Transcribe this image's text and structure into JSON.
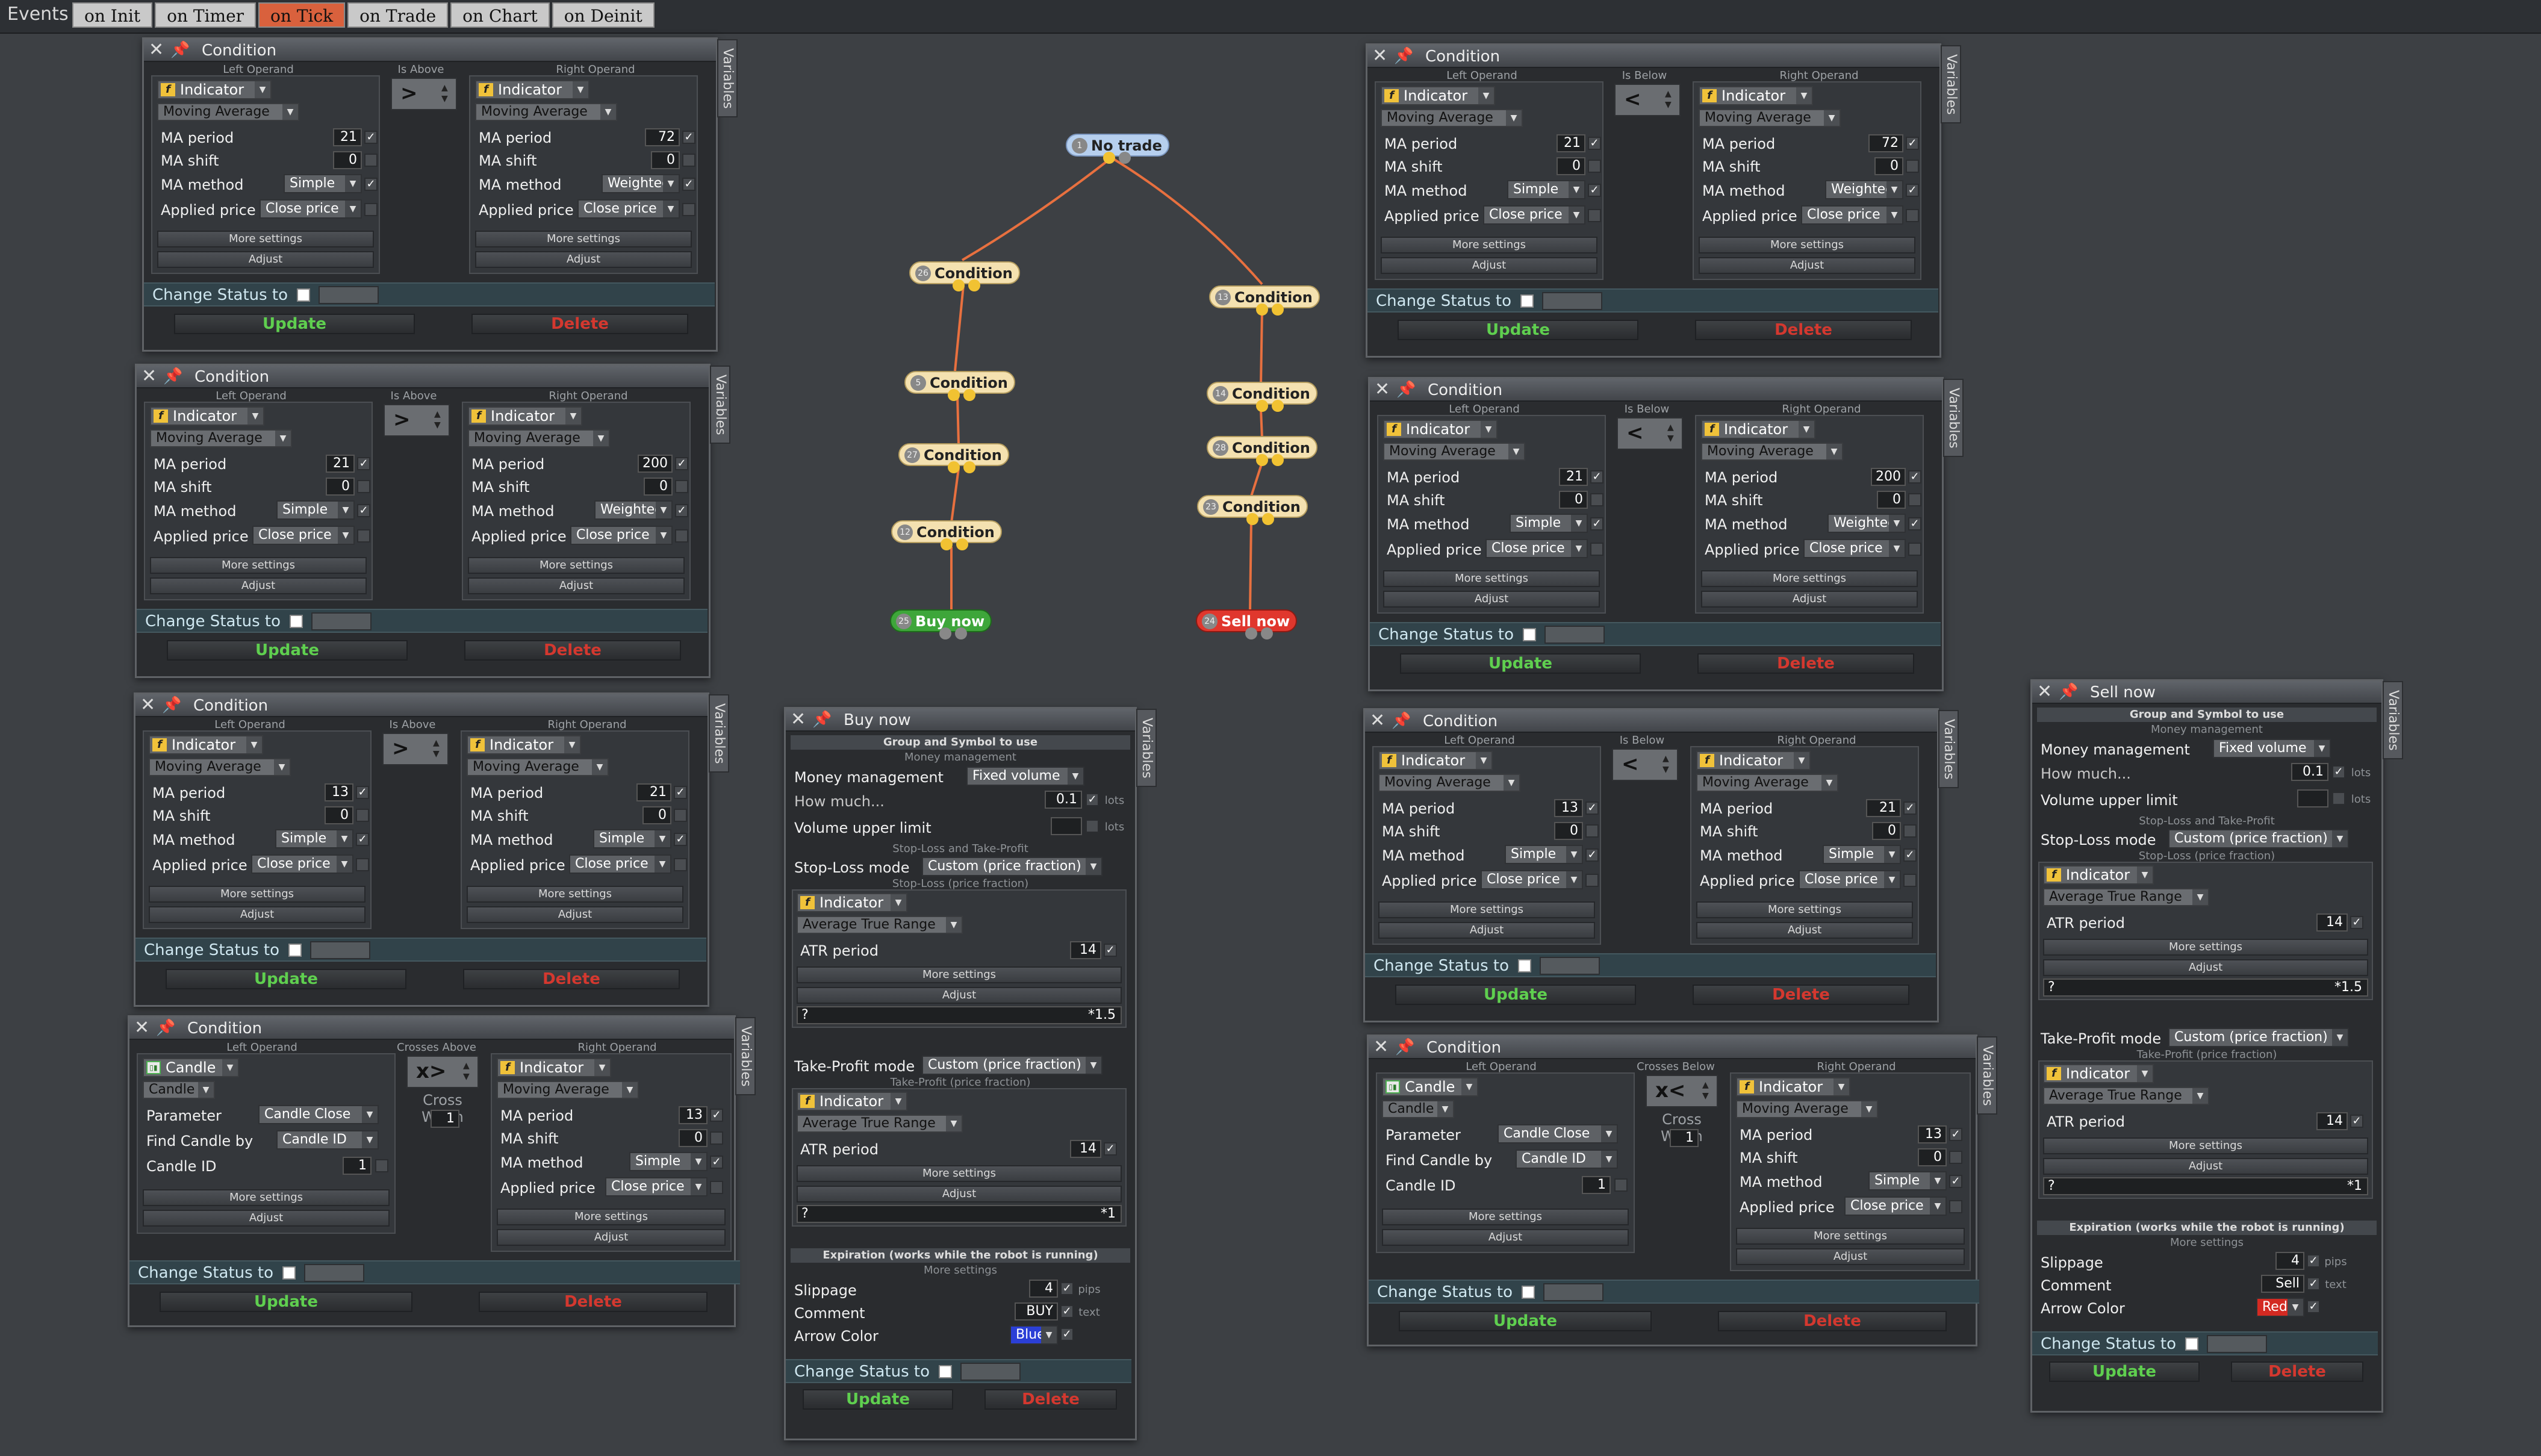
{
  "topbar": {
    "events_label": "Events",
    "tabs": [
      "on Init",
      "on Timer",
      "on Tick",
      "on Trade",
      "on Chart",
      "on Deinit"
    ],
    "active_tab": "on Tick"
  },
  "common": {
    "condition_title": "Condition",
    "variables_tab": "Variables",
    "left_operand": "Left Operand",
    "right_operand": "Right Operand",
    "indicator": "Indicator",
    "candle": "Candle",
    "candle_short": "Candle",
    "moving_average": "Moving Average",
    "ma_period": "MA period",
    "ma_shift": "MA shift",
    "ma_method": "MA method",
    "applied_price": "Applied price",
    "close_price": "Close price",
    "simple": "Simple",
    "weighted": "Weighted",
    "more_settings": "More settings",
    "adjust": "Adjust",
    "change_status": "Change Status to",
    "update": "Update",
    "delete": "Delete",
    "parameter": "Parameter",
    "candle_close": "Candle Close",
    "find_candle_by": "Find Candle by",
    "candle_id_sel": "Candle ID",
    "candle_id": "Candle ID",
    "cross_width": "Cross Width",
    "zero": "0",
    "one": "1"
  },
  "conditions": [
    {
      "relation": "Is Above",
      "symbol": ">",
      "left_period": "21",
      "right_period": "72",
      "right_method": "Weighted"
    },
    {
      "relation": "Is Above",
      "symbol": ">",
      "left_period": "21",
      "right_period": "200",
      "right_method": "Weighted"
    },
    {
      "relation": "Is Above",
      "symbol": ">",
      "left_period": "13",
      "right_period": "21",
      "right_method": "Simple"
    },
    {
      "relation": "Crosses Above",
      "symbol": "x>",
      "right_period": "13"
    },
    {
      "relation": "Is Below",
      "symbol": "<",
      "left_period": "21",
      "right_period": "72",
      "right_method": "Weighted"
    },
    {
      "relation": "Is Below",
      "symbol": "<",
      "left_period": "21",
      "right_period": "200",
      "right_method": "Weighted"
    },
    {
      "relation": "Is Below",
      "symbol": "<",
      "left_period": "13",
      "right_period": "21",
      "right_method": "Simple"
    },
    {
      "relation": "Crosses Below",
      "symbol": "x<",
      "right_period": "13"
    }
  ],
  "buy_panel": {
    "title": "Buy now",
    "group_symbol": "Group and Symbol to use",
    "money_mgmt_header": "Money management",
    "money_management": "Money management",
    "fixed_volume": "Fixed volume",
    "how_much": "How much...",
    "how_much_val": "0.1",
    "lots": "lots",
    "volume_upper_limit": "Volume upper limit",
    "sl_tp_header": "Stop-Loss and Take-Profit",
    "sl_mode": "Stop-Loss mode",
    "custom_price_fraction": "Custom (price fraction)",
    "sl_sub": "Stop-Loss (price fraction)",
    "atr": "Average True Range",
    "atr_period": "ATR period",
    "atr_val": "14",
    "q": "?",
    "sl_mult": "*1.5",
    "tp_mode": "Take-Profit mode",
    "tp_sub": "Take-Profit (price fraction)",
    "tp_mult": "*1",
    "expiration": "Expiration (works while the robot is running)",
    "slippage": "Slippage",
    "slippage_val": "4",
    "pips": "pips",
    "comment": "Comment",
    "comment_val": "BUY",
    "text": "text",
    "arrow_color": "Arrow Color",
    "arrow_color_val": "Blue",
    "arrow_hex": "#2b3fd6"
  },
  "sell_panel": {
    "title": "Sell now",
    "comment_val": "Sell",
    "arrow_color_val": "Red",
    "arrow_hex": "#d32a22"
  },
  "tree": {
    "nodes": [
      {
        "id": "1",
        "label": "No trade",
        "kind": "notrade"
      },
      {
        "id": "26",
        "label": "Condition",
        "kind": "cond"
      },
      {
        "id": "5",
        "label": "Condition",
        "kind": "cond"
      },
      {
        "id": "27",
        "label": "Condition",
        "kind": "cond"
      },
      {
        "id": "12",
        "label": "Condition",
        "kind": "cond"
      },
      {
        "id": "25",
        "label": "Buy now",
        "kind": "buy"
      },
      {
        "id": "13",
        "label": "Condition",
        "kind": "cond"
      },
      {
        "id": "14",
        "label": "Condition",
        "kind": "cond"
      },
      {
        "id": "28",
        "label": "Condition",
        "kind": "cond"
      },
      {
        "id": "23",
        "label": "Condition",
        "kind": "cond"
      },
      {
        "id": "24",
        "label": "Sell now",
        "kind": "sell"
      }
    ]
  },
  "colors": {
    "link": "#e8703f",
    "accent_tab": "#d9613d",
    "update_green": "#5fcf4f",
    "delete_red": "#d4382f"
  }
}
